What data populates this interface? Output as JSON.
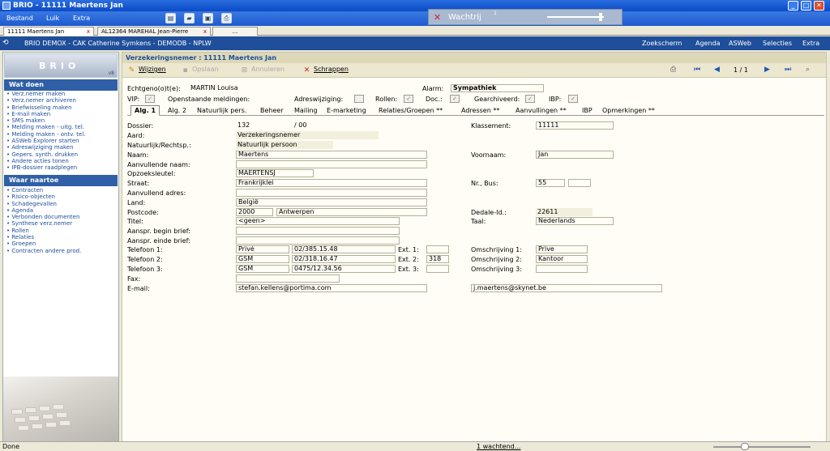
{
  "window": {
    "title": "BRIO - 11111 Maertens Jan"
  },
  "menu": {
    "items": [
      "Bestand",
      "Luik",
      "Extra"
    ]
  },
  "queue": {
    "label": "Wachtrij",
    "count": "1"
  },
  "doc_tabs": [
    {
      "label": "11111 Maertens Jan"
    },
    {
      "label": "AL12364 MAREHAL Jean-Pierre"
    },
    {
      "label": "..."
    }
  ],
  "header": {
    "breadcrumb": "BRIO DEMOX - CAK Catherine Symkens - DEMODB - NPLW",
    "nav": [
      "Zoekscherm",
      "Agenda",
      "ASWeb",
      "Selecties",
      "Extra"
    ]
  },
  "sidebar": {
    "logo": "BRIO",
    "version": "v8",
    "wat_doen": {
      "title": "Wat doen",
      "items": [
        "Verz.nemer maken",
        "Verz.nemer archiveren",
        "Briefwisseling maken",
        "E-mail maken",
        "SMS maken",
        "Melding maken - uitg. tel.",
        "Melding maken - ontv. tel.",
        "ASWeb Explorer starten",
        "Adreswijziging maken",
        "Gepers. synth. drukken",
        "Andere acties tonen",
        "IPB-dossier raadplegen"
      ]
    },
    "waar_naartoe": {
      "title": "Waar naartoe",
      "items": [
        "Contracten",
        "Risico-objecten",
        "Schadegevallen",
        "Agenda",
        "Verbonden documenten",
        "Synthese verz.nemer",
        "Rollen",
        "Relaties",
        "Groepen",
        "Contracten andere prod."
      ]
    }
  },
  "page": {
    "title": "Verzekeringsnemer : 11111 Maertens Jan"
  },
  "toolbar": {
    "wijzigen": "Wijzigen",
    "opslaan": "Opslaan",
    "annuleren": "Annuleren",
    "schrappen": "Schrappen",
    "pager": "1 / 1"
  },
  "info": {
    "echtgeno_label": "Echtgeno(o)t(e):",
    "echtgeno_value": "MARTIN Louisa",
    "alarm_label": "Alarm:",
    "alarm_value": "Sympathiek",
    "vip": "VIP:",
    "openstaande": "Openstaande meldingen:",
    "adreswijziging": "Adreswijziging:",
    "rollen": "Rollen:",
    "doc": "Doc.:",
    "gearchiveerd": "Gearchiveerd:",
    "ibp": "IBP:"
  },
  "tabs": [
    "Alg. 1",
    "Alg. 2",
    "Natuurlijk pers.",
    "Beheer",
    "Mailing",
    "E-marketing",
    "Relaties/Groepen **",
    "Adressen **",
    "Aanvullingen **",
    "IBP",
    "Opmerkingen **"
  ],
  "form": {
    "dossier_label": "Dossier:",
    "dossier_value": "132",
    "dossier_suffix": "/ 00",
    "klassement_label": "Klassement:",
    "klassement_value": "11111",
    "aard_label": "Aard:",
    "aard_value": "Verzekeringsnemer",
    "natuurlijk_label": "Natuurlijk/Rechtsp.:",
    "natuurlijk_value": "Natuurlijk persoon",
    "naam_label": "Naam:",
    "naam_value": "Maertens",
    "voornaam_label": "Voornaam:",
    "voornaam_value": "Jan",
    "aanvullende_naam_label": "Aanvullende naam:",
    "opzoeksleutel_label": "Opzoeksleutel:",
    "opzoeksleutel_value": "MAERTENSJ",
    "straat_label": "Straat:",
    "straat_value": "Frankrijklei",
    "nr_bus_label": "Nr., Bus:",
    "nr_value": "55",
    "aanvullend_adres_label": "Aanvullend adres:",
    "land_label": "Land:",
    "land_value": "België",
    "postcode_label": "Postcode:",
    "postcode_value": "2000",
    "gemeente_value": "Antwerpen",
    "dedale_label": "Dedale-Id.:",
    "dedale_value": "22611",
    "titel_label": "Titel:",
    "titel_value": "<geen>",
    "taal_label": "Taal:",
    "taal_value": "Nederlands",
    "begin_brief_label": "Aanspr. begin brief:",
    "einde_brief_label": "Aanspr. einde brief:",
    "tel1_label": "Telefoon 1:",
    "tel1_type": "Privé",
    "tel1_nr": "02/385.15.48",
    "ext1_label": "Ext. 1:",
    "oms1_label": "Omschrijving 1:",
    "oms1_value": "Prive",
    "tel2_label": "Telefoon 2:",
    "tel2_type": "GSM",
    "tel2_nr": "02/318.16.47",
    "ext2_label": "Ext. 2:",
    "ext2_value": "318",
    "oms2_label": "Omschrijving 2:",
    "oms2_value": "Kantoor",
    "tel3_label": "Telefoon 3:",
    "tel3_type": "GSM",
    "tel3_nr": "0475/12.34.56",
    "ext3_label": "Ext. 3:",
    "oms3_label": "Omschrijving 3:",
    "fax_label": "Fax:",
    "email_label": "E-mail:",
    "email1": "stefan.kellens@portima.com",
    "email2": "j.maertens@skynet.be"
  },
  "status": {
    "left": "Done",
    "center": "1 wachtend..."
  }
}
